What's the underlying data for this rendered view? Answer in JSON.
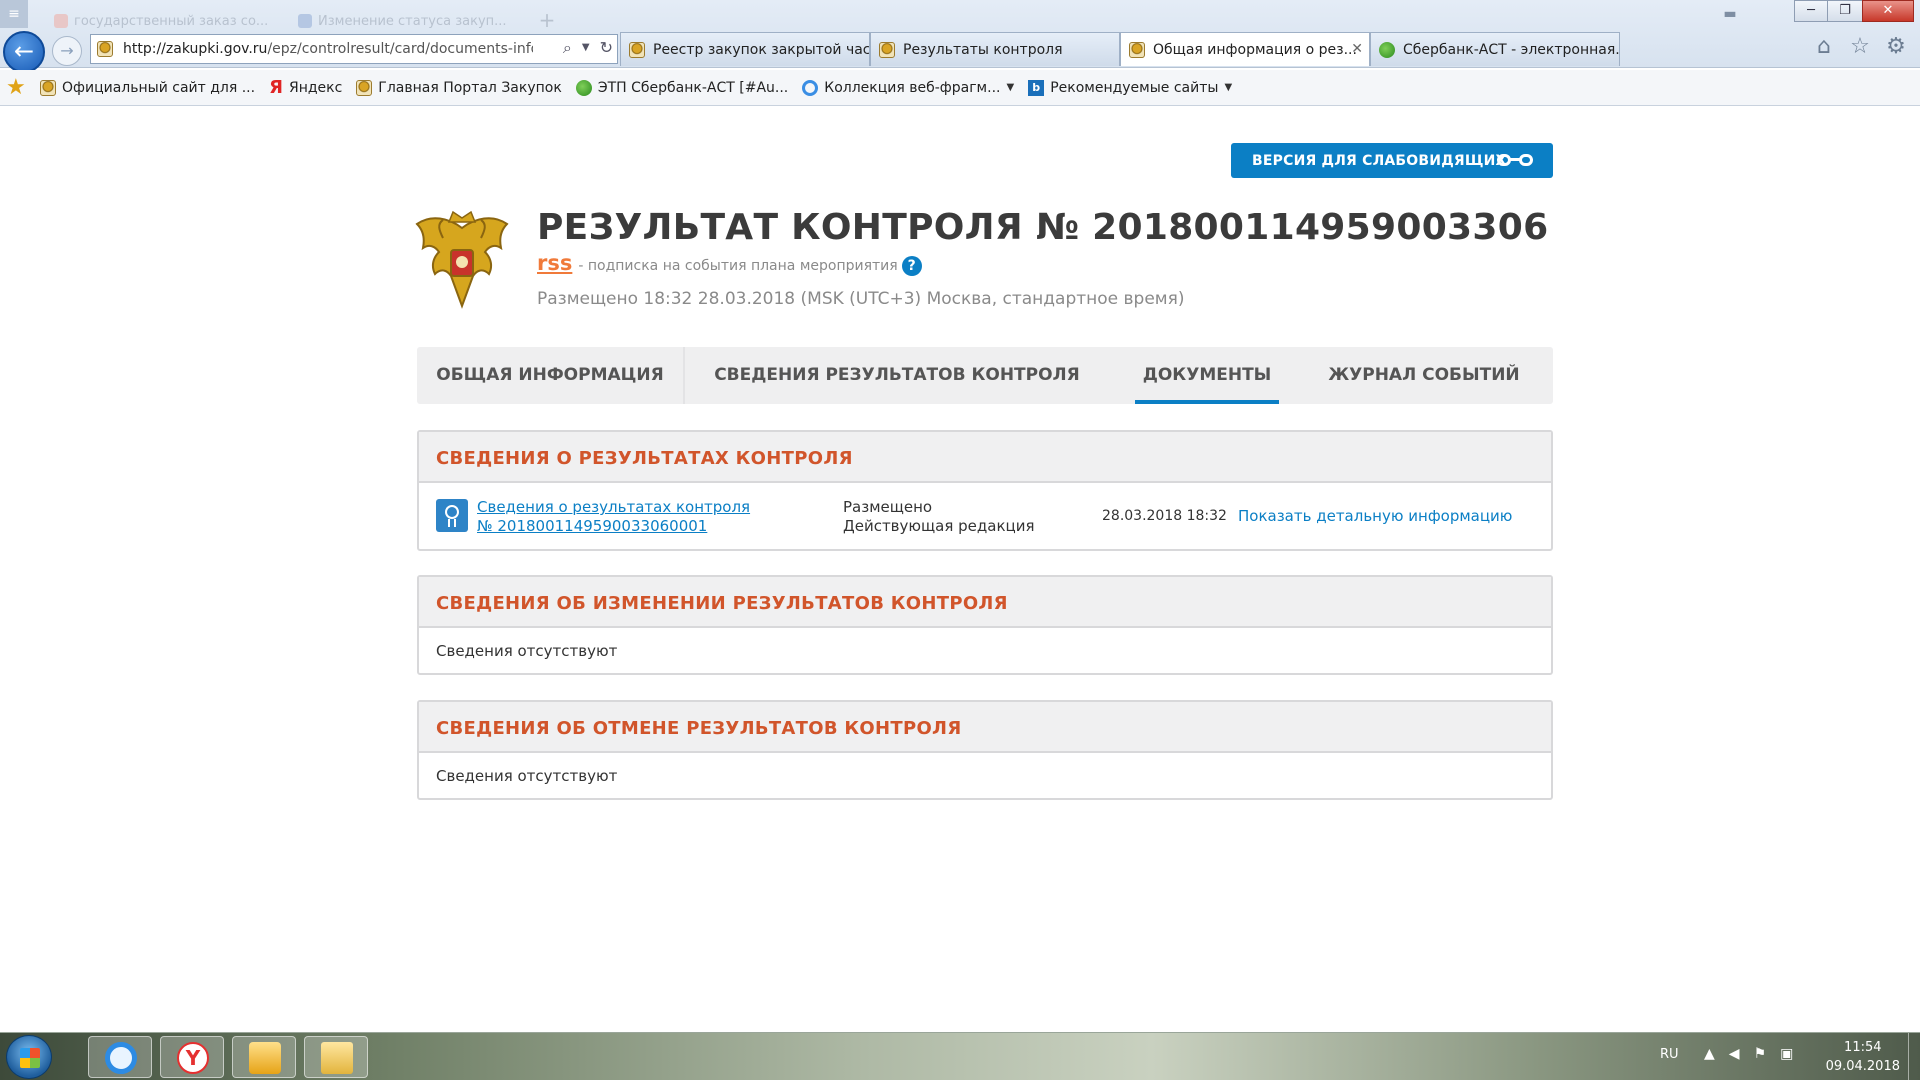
{
  "browser": {
    "ghost_tabs": [
      "государственный заказ со...",
      "Изменение статуса закуп..."
    ],
    "url_host": "http://zakupki.gov.ru",
    "url_path": "/epz/controlresult/card/documents-info.h",
    "tabs": [
      {
        "label": "Реестр закупок закрытой час...",
        "icon": "emblem"
      },
      {
        "label": "Результаты контроля",
        "icon": "emblem"
      },
      {
        "label": "Общая информация о рез...",
        "icon": "emblem",
        "active": true
      },
      {
        "label": "Сбербанк-АСТ - электронная...",
        "icon": "sberbank"
      }
    ],
    "favorites": [
      {
        "label": "Официальный сайт для ...",
        "icon": "emblem"
      },
      {
        "label": "Яндекс",
        "icon": "yandex"
      },
      {
        "label": "Главная Портал Закупок",
        "icon": "emblem"
      },
      {
        "label": "ЭТП Сбербанк-АСТ [#Au...",
        "icon": "sberbank"
      },
      {
        "label": "Коллекция веб-фрагм...",
        "icon": "ie",
        "dropdown": true
      },
      {
        "label": "Рекомендуемые сайты",
        "icon": "bing",
        "dropdown": true
      }
    ]
  },
  "page": {
    "vision_button": "ВЕРСИЯ ДЛЯ СЛАБОВИДЯЩИХ",
    "title": "РЕЗУЛЬТАТ КОНТРОЛЯ № 201800114959003306",
    "rss_label": "rss",
    "rss_caption": "- подписка на события плана мероприятия",
    "help": "?",
    "posted": "Размещено 18:32 28.03.2018 (MSK (UTC+3) Москва, стандартное время)",
    "tabs": [
      "ОБЩАЯ ИНФОРМАЦИЯ",
      "СВЕДЕНИЯ РЕЗУЛЬТАТОВ КОНТРОЛЯ",
      "ДОКУМЕНТЫ",
      "ЖУРНАЛ СОБЫТИЙ"
    ],
    "active_tab": "ДОКУМЕНТЫ",
    "sections": [
      {
        "title": "СВЕДЕНИЯ О РЕЗУЛЬТАТАХ КОНТРОЛЯ",
        "doc": {
          "link_line1": "Сведения о результатах контроля",
          "link_line2": "№ 2018001149590033060001",
          "status_line1": "Размещено",
          "status_line2": "Действующая редакция",
          "date": "28.03.2018 18:32",
          "detail": "Показать детальную информацию"
        }
      },
      {
        "title": "СВЕДЕНИЯ ОБ ИЗМЕНЕНИИ РЕЗУЛЬТАТОВ КОНТРОЛЯ",
        "empty": "Сведения отсутствуют"
      },
      {
        "title": "СВЕДЕНИЯ ОБ ОТМЕНЕ РЕЗУЛЬТАТОВ КОНТРОЛЯ",
        "empty": "Сведения отсутствуют"
      }
    ]
  },
  "taskbar": {
    "apps": [
      "Internet Explorer",
      "Yandex Browser",
      "Mail",
      "Explorer"
    ],
    "lang": "RU",
    "time": "11:54",
    "date": "09.04.2018"
  },
  "colors": {
    "accent_blue": "#0b7fc5",
    "section_title_red": "#d1552b",
    "rss_orange": "#f07a3a"
  }
}
